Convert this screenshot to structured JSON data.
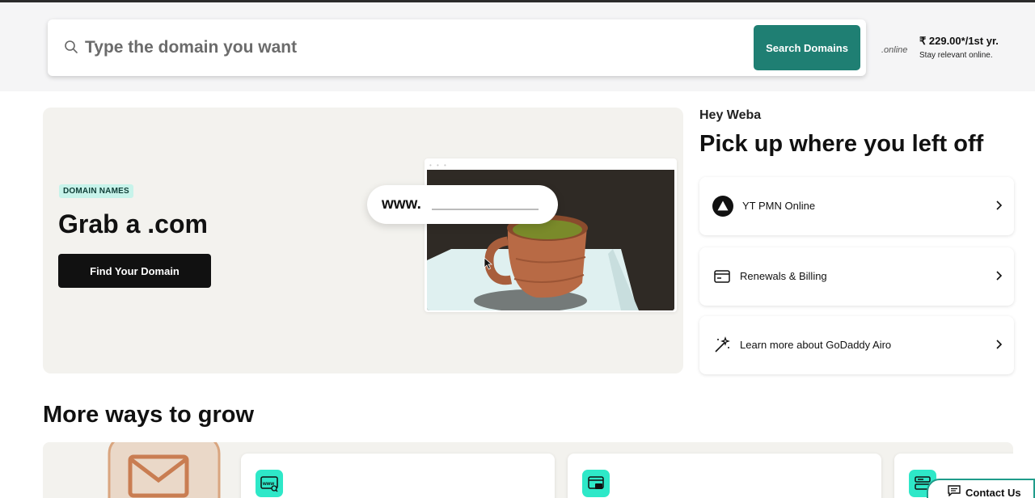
{
  "search": {
    "placeholder": "Type the domain you want",
    "button_label": "Search Domains"
  },
  "promo": {
    "tld": ".online",
    "price": "₹ 229.00*/1st yr.",
    "tagline": "Stay relevant online."
  },
  "hero": {
    "badge": "DOMAIN NAMES",
    "title": "Grab a .com",
    "button_label": "Find Your Domain",
    "url_prefix": "www."
  },
  "account": {
    "greeting": "Hey Weba",
    "title": "Pick up where you left off",
    "cards": [
      {
        "label": "YT PMN Online",
        "icon": "triangle-logo-icon"
      },
      {
        "label": "Renewals & Billing",
        "icon": "credit-card-icon"
      },
      {
        "label": "Learn more about GoDaddy Airo",
        "icon": "magic-wand-icon"
      }
    ]
  },
  "grow": {
    "title": "More ways to grow",
    "cards": [
      {
        "icon": "www-search-icon"
      },
      {
        "icon": "store-icon"
      },
      {
        "icon": "server-icon"
      }
    ]
  },
  "contact": {
    "label": "Contact Us"
  },
  "colors": {
    "accent": "#1f7f73",
    "badge_bg": "#c7f3ea",
    "icon_tile": "#2ee8c8",
    "hero_bg": "#f3f2ee"
  }
}
